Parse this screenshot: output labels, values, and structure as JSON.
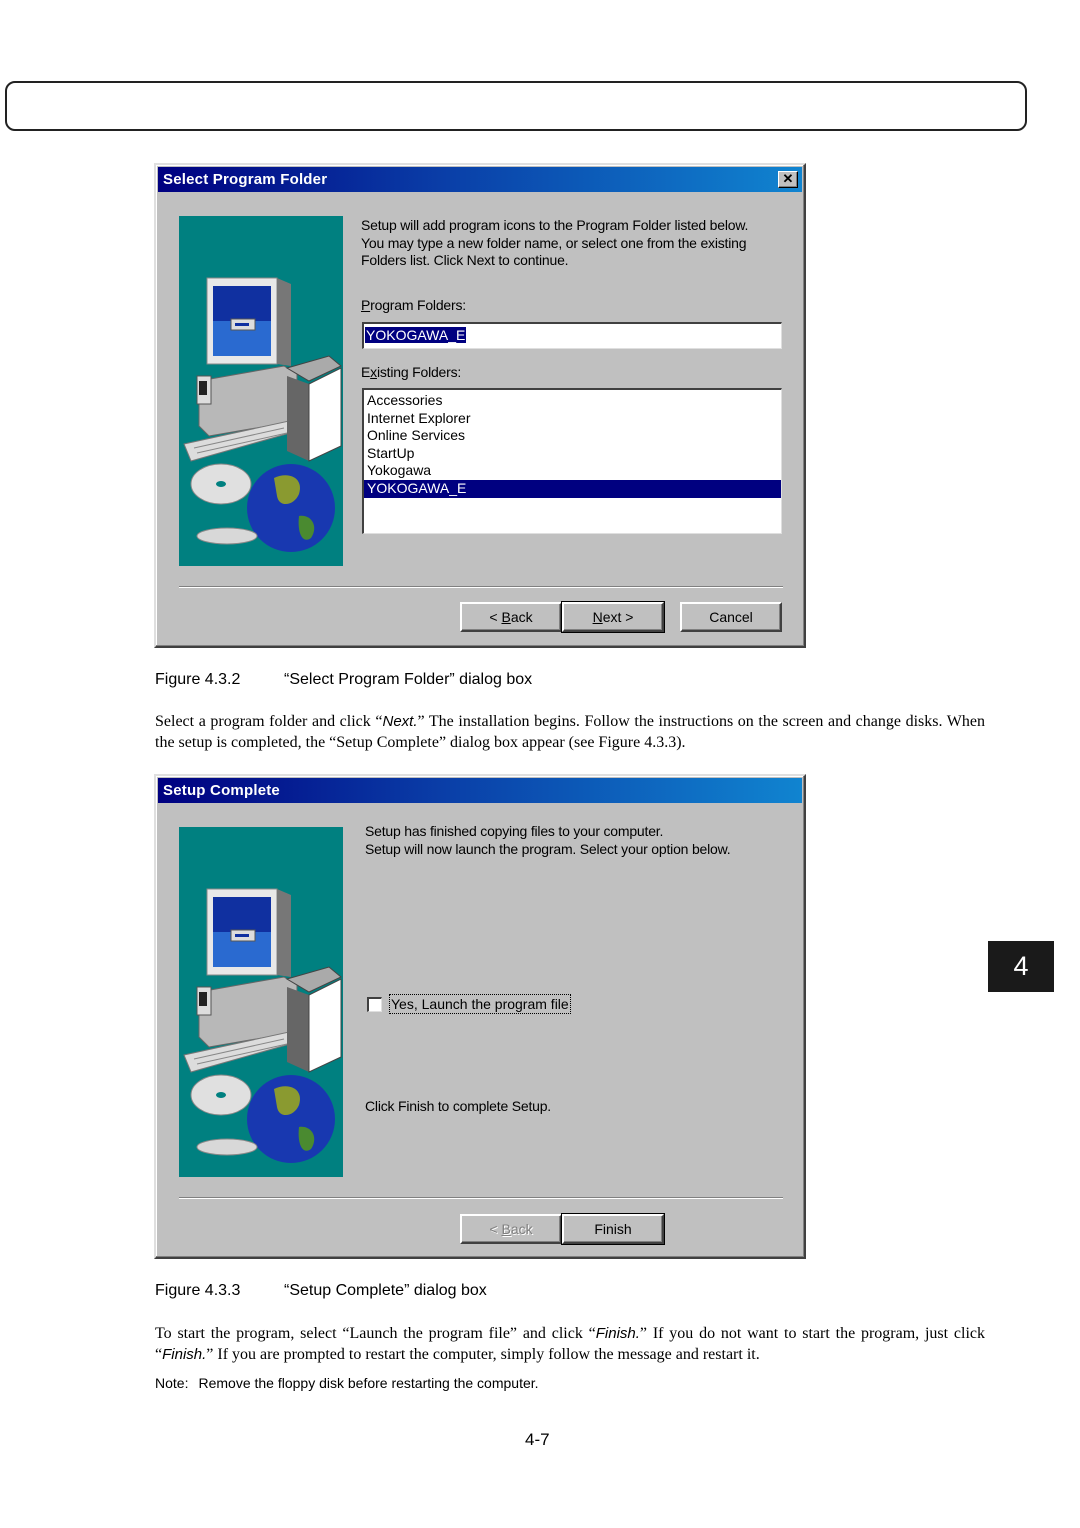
{
  "page": {
    "chapter_tab": "4",
    "page_number": "4-7"
  },
  "dialog1": {
    "title": "Select Program Folder",
    "close_icon": "close-icon",
    "intro_lines": [
      "Setup will add program icons to the Program Folder listed below.",
      "You may type a new folder name, or select one from the existing",
      "Folders list.  Click Next to continue."
    ],
    "program_folders_label_accel": "P",
    "program_folders_label_rest": "rogram Folders:",
    "program_folder_value": "YOKOGAWA_E",
    "existing_folders_label_pre": "E",
    "existing_folders_label_accel": "x",
    "existing_folders_label_rest": "isting Folders:",
    "existing_folders": [
      {
        "label": "Accessories",
        "selected": false
      },
      {
        "label": "Internet Explorer",
        "selected": false
      },
      {
        "label": "Online Services",
        "selected": false
      },
      {
        "label": "StartUp",
        "selected": false
      },
      {
        "label": "Yokogawa",
        "selected": false
      },
      {
        "label": "YOKOGAWA_E",
        "selected": true
      }
    ],
    "buttons": {
      "back_pre": "< ",
      "back_accel": "B",
      "back_rest": "ack",
      "next_accel": "N",
      "next_rest": "ext >",
      "cancel": "Cancel"
    },
    "art_icon": "computer-cd-globe-illustration"
  },
  "caption1": {
    "number": "Figure 4.3.2",
    "title": "“Select Program Folder” dialog box"
  },
  "para1": {
    "t1": "Select a program folder and click “",
    "b1": "Next.",
    "t2": "” The installation begins. Follow the instructions on the screen and change disks. When the setup is completed, the “Setup Complete” dialog box appear (see Figure 4.3.3)."
  },
  "dialog2": {
    "title": "Setup Complete",
    "intro_lines": [
      "Setup has finished copying files to your computer.",
      "Setup will now launch the program. Select your option below."
    ],
    "checkbox_label": "Yes, Launch the program file",
    "checkbox_checked": false,
    "finish_hint": "Click Finish to complete Setup.",
    "buttons": {
      "back_pre": "< ",
      "back_accel": "B",
      "back_rest": "ack",
      "back_disabled": true,
      "finish": "Finish"
    }
  },
  "caption2": {
    "number": "Figure 4.3.3",
    "title": "“Setup Complete” dialog box"
  },
  "para2": {
    "t1": "To start the program, select “Launch the program file” and click “",
    "b1": "Finish.",
    "t2": "” If you do not want to start the program, just click “",
    "b2": "Finish.",
    "t3": "” If you are prompted to restart the computer, simply follow the message and restart it."
  },
  "note": {
    "label": "Note:",
    "text": "Remove the floppy disk before restarting the computer."
  },
  "colors": {
    "title_bar_start": "#000080",
    "title_bar_end": "#1084d0",
    "dialog_face": "#c0c0c0",
    "art_background": "#008080",
    "selection": "#000080"
  }
}
